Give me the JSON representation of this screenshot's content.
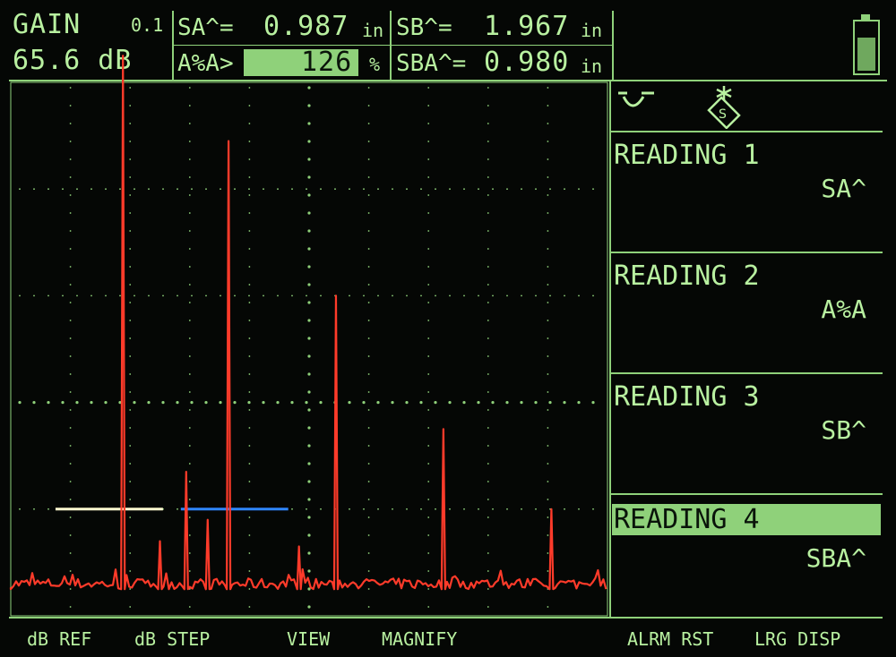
{
  "header": {
    "gain_label": "GAIN",
    "gain_step": "0.1",
    "gain_value": "65.6 dB",
    "sa_label": "SA^=",
    "sa_value": "0.987",
    "sa_unit": "in",
    "sb_label": "SB^=",
    "sb_value": "1.967",
    "sb_unit": "in",
    "ara_label": "A%A>",
    "ara_value": "126",
    "ara_unit": "%",
    "sba_label": "SBA^=",
    "sba_value": "0.980",
    "sba_unit": "in",
    "battery_level": 0.72
  },
  "panel": {
    "icons": [
      "gate-icon",
      "probe-icon"
    ],
    "readings": [
      {
        "title": "READING 1",
        "value": "SA^"
      },
      {
        "title": "READING 2",
        "value": "A%A"
      },
      {
        "title": "READING 3",
        "value": "SB^"
      },
      {
        "title": "READING 4",
        "value": "SBA^"
      }
    ],
    "active_reading": 4
  },
  "footer": {
    "keys": [
      "dB REF",
      "dB STEP",
      "VIEW",
      "MAGNIFY",
      "ALRM RST",
      "LRG DISP"
    ]
  },
  "colors": {
    "screen_text": "#b8f0a0",
    "grid": "#8fd17a",
    "echo": "#ff3b2a",
    "gate_a": "#fffbd0",
    "gate_b": "#2f86ff"
  },
  "waveform": {
    "baseline_pct": 5,
    "echoes": [
      {
        "pos_pct": 18.8,
        "height_pct": 100
      },
      {
        "pos_pct": 25.0,
        "height_pct": 9
      },
      {
        "pos_pct": 29.4,
        "height_pct": 22
      },
      {
        "pos_pct": 33.0,
        "height_pct": 13
      },
      {
        "pos_pct": 36.5,
        "height_pct": 84
      },
      {
        "pos_pct": 48.3,
        "height_pct": 8
      },
      {
        "pos_pct": 54.5,
        "height_pct": 55
      },
      {
        "pos_pct": 72.5,
        "height_pct": 30
      },
      {
        "pos_pct": 90.6,
        "height_pct": 15
      }
    ],
    "gate_a": {
      "start_pct": 7.5,
      "end_pct": 25.5,
      "level_pct": 20
    },
    "gate_b": {
      "start_pct": 28.5,
      "end_pct": 46.5,
      "level_pct": 20
    }
  }
}
